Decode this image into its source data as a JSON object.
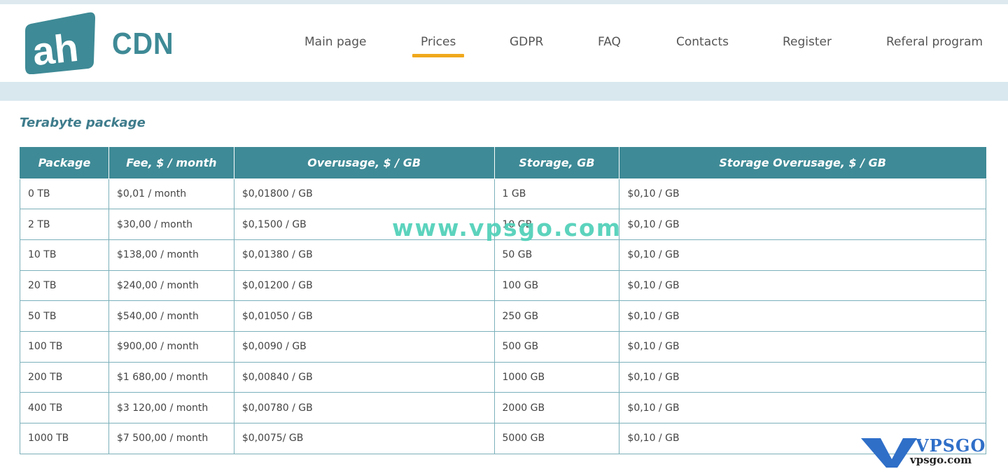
{
  "brand": {
    "logo_text": "CDN",
    "logo_mark": "ah"
  },
  "nav": {
    "items": [
      {
        "label": "Main page"
      },
      {
        "label": "Prices",
        "active": true
      },
      {
        "label": "GDPR"
      },
      {
        "label": "FAQ"
      },
      {
        "label": "Contacts"
      },
      {
        "label": "Register"
      },
      {
        "label": "Referal program"
      }
    ]
  },
  "section": {
    "title": "Terabyte package"
  },
  "table": {
    "headers": [
      "Package",
      "Fee, $ / month",
      "Overusage, $ / GB",
      "Storage, GB",
      "Storage Overusage, $ / GB"
    ],
    "rows": [
      [
        "0 TB",
        "$0,01 / month",
        "$0,01800 / GB",
        "1 GB",
        "$0,10 / GB"
      ],
      [
        "2 TB",
        "$30,00 / month",
        "$0,1500 / GB",
        "10 GB",
        "$0,10 / GB"
      ],
      [
        "10 TB",
        "$138,00 / month",
        "$0,01380 / GB",
        "50 GB",
        "$0,10 / GB"
      ],
      [
        "20 TB",
        "$240,00 / month",
        "$0,01200 / GB",
        "100 GB",
        "$0,10 / GB"
      ],
      [
        "50 TB",
        "$540,00 / month",
        "$0,01050 / GB",
        "250 GB",
        "$0,10 / GB"
      ],
      [
        "100 TB",
        "$900,00 / month",
        "$0,0090 / GB",
        "500 GB",
        "$0,10 / GB"
      ],
      [
        "200 TB",
        "$1 680,00 / month",
        "$0,00840 / GB",
        "1000 GB",
        "$0,10 / GB"
      ],
      [
        "400 TB",
        "$3 120,00 / month",
        "$0,00780 / GB",
        "2000 GB",
        "$0,10 / GB"
      ],
      [
        "1000 TB",
        "$7 500,00 / month",
        "$0,0075/ GB",
        "5000 GB",
        "$0,10 / GB"
      ]
    ]
  },
  "watermark": {
    "text": "www.vpsgo.com"
  },
  "badge": {
    "brand": "VPSGO",
    "url": "vpsgo.com"
  },
  "colors": {
    "accent": "#3e8a96",
    "active_underline": "#f0a81c",
    "band": "#d8e8ee"
  }
}
